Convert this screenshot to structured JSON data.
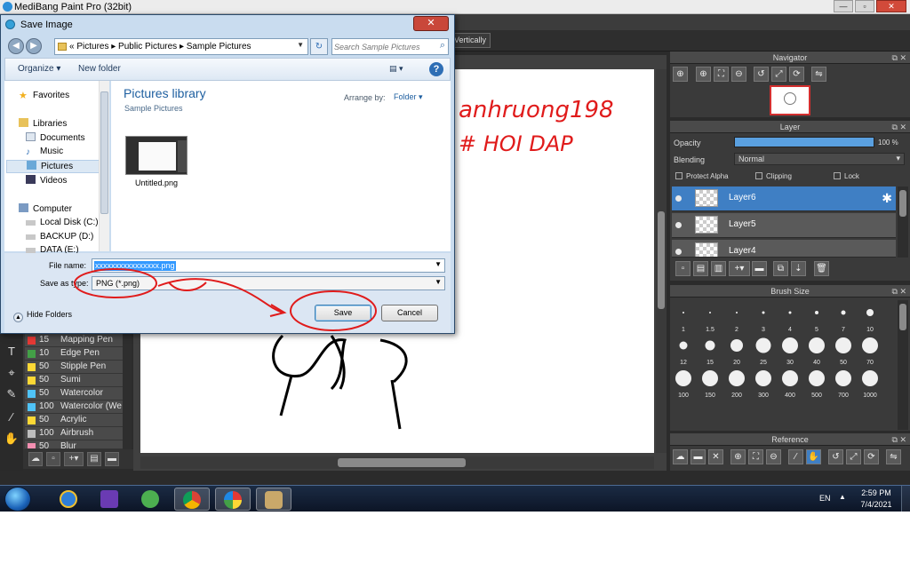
{
  "app": {
    "title": "MediBang Paint Pro (32bit)",
    "vertically_label": "Vertically",
    "win_min": "—",
    "win_max": "▫",
    "win_close": "✕"
  },
  "dialog": {
    "title": "Save Image",
    "close_glyph": "✕",
    "breadcrumb": "« Pictures ▸ Public Pictures ▸ Sample Pictures",
    "search_placeholder": "Search Sample Pictures",
    "organize_label": "Organize ▾",
    "new_folder_label": "New folder",
    "help_glyph": "?",
    "nav": {
      "favorites": "Favorites",
      "libraries": "Libraries",
      "documents": "Documents",
      "music": "Music",
      "pictures": "Pictures",
      "videos": "Videos",
      "computer": "Computer",
      "local_disk": "Local Disk (C:)",
      "backup": "BACKUP (D:)",
      "data": "DATA (E:)"
    },
    "library_title": "Pictures library",
    "library_sub": "Sample Pictures",
    "arrange_by_label": "Arrange by:",
    "arrange_by_value": "Folder ▾",
    "file_item_name": "Untitled.png",
    "file_name_label": "File name:",
    "file_name_value": "xxxxxxxxxxxxxxxx.png",
    "save_as_type_label": "Save as type:",
    "save_as_type_value": "PNG (*.png)",
    "hide_folders_label": "Hide Folders",
    "save_label": "Save",
    "cancel_label": "Cancel"
  },
  "brushes": [
    {
      "size": "15",
      "name": "Mapping Pen",
      "color": "#e53935"
    },
    {
      "size": "10",
      "name": "Edge Pen",
      "color": "#43a047"
    },
    {
      "size": "50",
      "name": "Stipple Pen",
      "color": "#fdd835"
    },
    {
      "size": "50",
      "name": "Sumi",
      "color": "#fdd835"
    },
    {
      "size": "50",
      "name": "Watercolor",
      "color": "#4fc3f7"
    },
    {
      "size": "100",
      "name": "Watercolor (We",
      "color": "#4fc3f7"
    },
    {
      "size": "50",
      "name": "Acrylic",
      "color": "#fdd835"
    },
    {
      "size": "100",
      "name": "Airbrush",
      "color": "#bdbdbd"
    },
    {
      "size": "50",
      "name": "Blur",
      "color": "#f48fb1"
    }
  ],
  "navigator": {
    "title": "Navigator"
  },
  "layer_panel": {
    "title": "Layer",
    "opacity_label": "Opacity",
    "opacity_value": "100 %",
    "opacity_level": 1.0,
    "blending_label": "Blending",
    "blending_value": "Normal",
    "protect_alpha": "Protect Alpha",
    "clipping": "Clipping",
    "lock": "Lock",
    "layers": [
      "Layer6",
      "Layer5",
      "Layer4"
    ],
    "selected_layer": "Layer6"
  },
  "brush_size": {
    "title": "Brush Size",
    "sizes": [
      "1",
      "1.5",
      "2",
      "3",
      "4",
      "5",
      "7",
      "10",
      "12",
      "15",
      "20",
      "25",
      "30",
      "40",
      "50",
      "70",
      "100",
      "150",
      "200",
      "300",
      "400",
      "500",
      "700",
      "1000"
    ]
  },
  "reference": {
    "title": "Reference"
  },
  "canvas": {
    "text_line1": "anhruong198",
    "text_line2": "# HOI DAP"
  },
  "taskbar": {
    "lang": "EN",
    "tray_arrow": "▲",
    "time": "2:59 PM",
    "date": "7/4/2021"
  },
  "colors": {
    "selected_layer": "#3f7fc4",
    "annotation_red": "#e01b1b",
    "dialog_frame": "#c9dcef",
    "library_title": "#1e5fa0"
  }
}
